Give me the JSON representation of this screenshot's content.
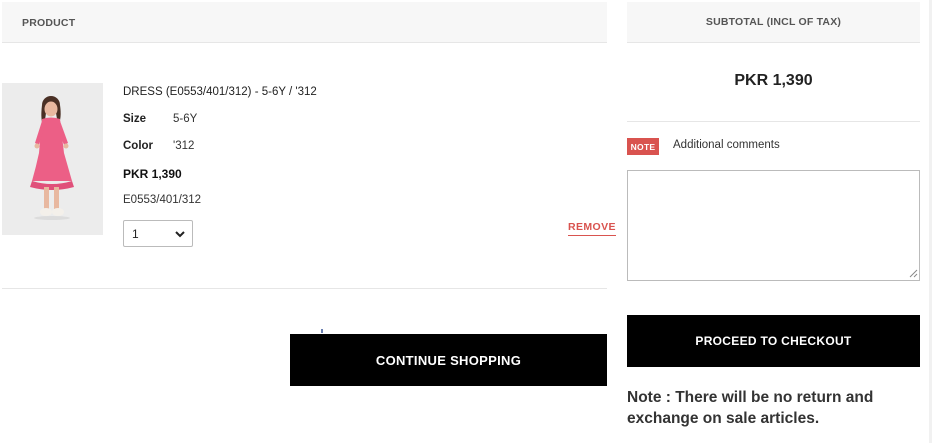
{
  "cart": {
    "product_column_header": "PRODUCT",
    "item": {
      "name": "DRESS (E0553/401/312) - 5-6Y / '312",
      "size_label": "Size",
      "size_value": "5-6Y",
      "color_label": "Color",
      "color_value": "'312",
      "price": "PKR 1,390",
      "sku": "E0553/401/312",
      "quantity": "1",
      "remove_label": "REMOVE",
      "thumbnail_icon": "pink-dress-photo"
    },
    "continue_label": "CONTINUE SHOPPING"
  },
  "summary": {
    "subtotal_header": "SUBTOTAL (INCL OF TAX)",
    "subtotal_amount": "PKR 1,390",
    "note_badge": "NOTE",
    "note_label": "Additional comments",
    "comments_value": "",
    "checkout_label": "PROCEED TO CHECKOUT",
    "sale_note": "Note : There will be no return and exchange on sale articles."
  },
  "colors": {
    "accent_red": "#d9534f",
    "button_black": "#000000",
    "header_gray": "#f7f7f7"
  }
}
